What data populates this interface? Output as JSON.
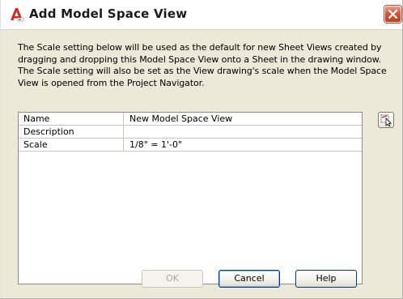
{
  "window": {
    "title": "Add Model Space View",
    "app_icon": "autocad-a-icon",
    "close_icon": "close-x-icon"
  },
  "description": "The Scale setting below will be used as the default for new Sheet Views created by dragging and dropping this Model Space View onto a Sheet in the drawing window. The Scale setting will also be set as the View drawing's scale when the Model Space View is opened from the Project Navigator.",
  "properties": [
    {
      "name": "Name",
      "value": "New Model Space View"
    },
    {
      "name": "Description",
      "value": ""
    },
    {
      "name": "Scale",
      "value": "1/8\" = 1'-0\""
    }
  ],
  "side_button": {
    "icon": "select-view-cursor-icon"
  },
  "buttons": {
    "ok": "OK",
    "cancel": "Cancel",
    "help": "Help"
  },
  "colors": {
    "dialog_bg": "#ece9d8",
    "close_button": "#d0583a",
    "button_border": "#003c74",
    "app_icon_red": "#d12a1f"
  }
}
